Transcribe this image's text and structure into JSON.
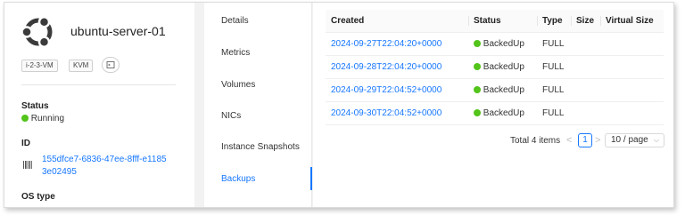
{
  "vm": {
    "name": "ubuntu-server-01",
    "chips": [
      "i-2-3-VM",
      "KVM"
    ],
    "status_label": "Status",
    "status_value": "Running",
    "id_label": "ID",
    "id_line1": "155dfce7-6836-47ee-8fff-e1185",
    "id_line2": "3e02495",
    "os_label": "OS type"
  },
  "tabs": [
    {
      "label": "Details"
    },
    {
      "label": "Metrics"
    },
    {
      "label": "Volumes"
    },
    {
      "label": "NICs"
    },
    {
      "label": "Instance Snapshots"
    },
    {
      "label": "Backups",
      "active": true
    }
  ],
  "table": {
    "columns": [
      "Created",
      "Status",
      "Type",
      "Size",
      "Virtual Size"
    ],
    "rows": [
      {
        "created": "2024-09-27T22:04:20+0000",
        "status": "BackedUp",
        "type": "FULL",
        "size": "",
        "virtual_size": ""
      },
      {
        "created": "2024-09-28T22:04:20+0000",
        "status": "BackedUp",
        "type": "FULL",
        "size": "",
        "virtual_size": ""
      },
      {
        "created": "2024-09-29T22:04:52+0000",
        "status": "BackedUp",
        "type": "FULL",
        "size": "",
        "virtual_size": ""
      },
      {
        "created": "2024-09-30T22:04:52+0000",
        "status": "BackedUp",
        "type": "FULL",
        "size": "",
        "virtual_size": ""
      }
    ]
  },
  "pagination": {
    "total": "Total 4 items",
    "prev": "<",
    "current": "1",
    "next": ">",
    "page_size": "10 / page"
  },
  "colors": {
    "accent": "#1677ff",
    "status_ok": "#52c41a"
  },
  "icons": [
    "ubuntu-logo-icon",
    "console-icon",
    "barcode-icon",
    "chevron-down-icon"
  ]
}
